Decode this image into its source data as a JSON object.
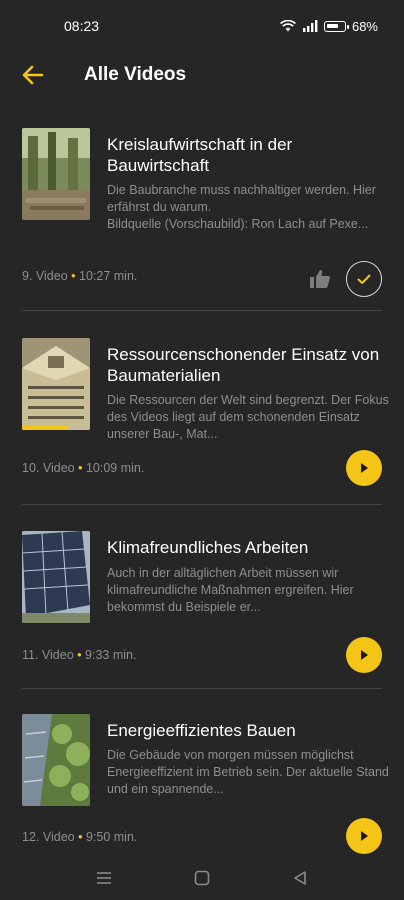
{
  "status": {
    "time": "08:23",
    "battery": "68%"
  },
  "header": {
    "title": "Alle Videos"
  },
  "videos": [
    {
      "title": "Kreislaufwirtschaft in der Bauwirtschaft",
      "description": "Die Baubranche muss nachhaltiger werden. Hier erfährst du warum.\nBildquelle (Vorschaubild): Ron Lach auf Pexe...",
      "number": "9. Video",
      "duration": "10:27 min.",
      "state": "completed"
    },
    {
      "title": "Ressourcenschonender Einsatz von Baumaterialien",
      "description": "Die Ressourcen der Welt sind begrenzt. Der Fokus des Videos liegt auf dem schonenden Einsatz unserer Bau-, Mat...",
      "number": "10. Video",
      "duration": "10:09 min.",
      "state": "in-progress",
      "progress": 0.68
    },
    {
      "title": "Klimafreundliches Arbeiten",
      "description": "Auch in der alltäglichen Arbeit müssen wir klimafreundliche Maßnahmen ergreifen. Hier bekommst du Beispiele er...",
      "number": "11. Video",
      "duration": "9:33 min.",
      "state": "not-started"
    },
    {
      "title": "Energieeffizientes Bauen",
      "description": "Die Gebäude von morgen müssen möglichst Energieeffizient im Betrieb sein. Der aktuelle Stand und ein spannende...",
      "number": "12. Video",
      "duration": "9:50 min.",
      "state": "not-started"
    }
  ],
  "meta_separator": "•",
  "colors": {
    "background": "#262626",
    "accent": "#f5c518",
    "muted_text": "#8e8e8e",
    "divider": "#444444"
  },
  "icons": {
    "back": "arrow-left-icon",
    "like": "thumbs-up-icon",
    "done": "checkmark-icon",
    "play": "play-icon",
    "nav": [
      "menu-icon",
      "home-square-icon",
      "back-triangle-icon"
    ]
  }
}
